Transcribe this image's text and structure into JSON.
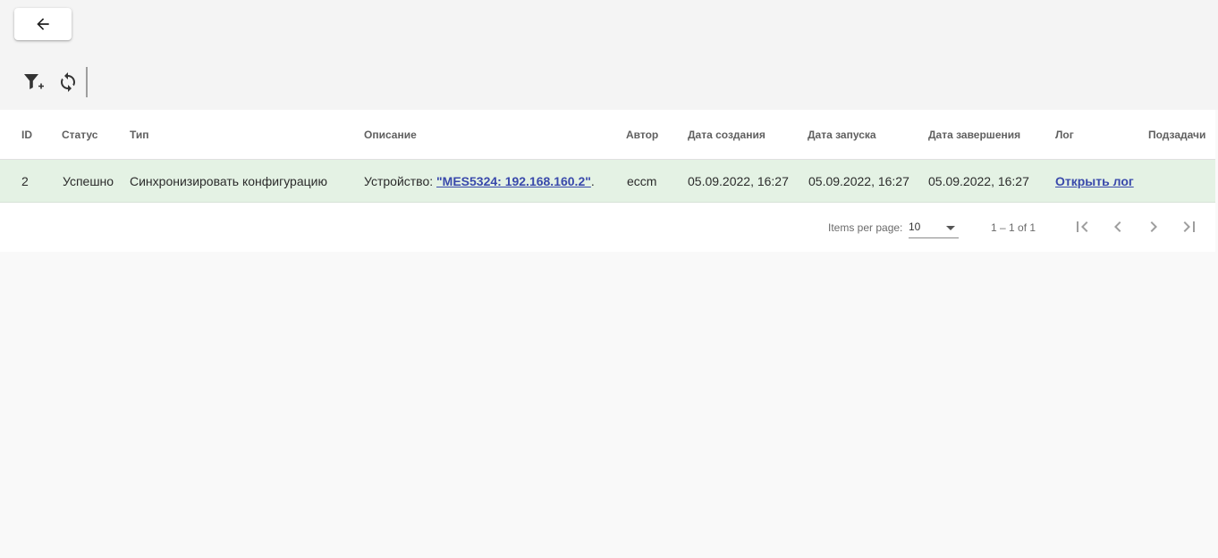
{
  "toolbar": {
    "back_icon": "arrow-left-icon",
    "filter_icon": "filter-add-icon",
    "refresh_icon": "sync-icon"
  },
  "table": {
    "columns": [
      "ID",
      "Статус",
      "Тип",
      "Описание",
      "Автор",
      "Дата создания",
      "Дата запуска",
      "Дата завершения",
      "Лог",
      "Подзадачи"
    ],
    "rows": [
      {
        "id": "2",
        "status": "Успешно",
        "type": "Синхронизировать конфигурацию",
        "description_prefix": "Устройство: ",
        "description_link": "\"MES5324: 192.168.160.2\"",
        "description_suffix": ".",
        "author": "eccm",
        "created": "05.09.2022, 16:27",
        "started": "05.09.2022, 16:27",
        "finished": "05.09.2022, 16:27",
        "log_link": "Открыть лог",
        "subtasks": ""
      }
    ],
    "success_row_color": "#e4f2e4"
  },
  "paginator": {
    "items_per_page_label": "Items per page:",
    "page_size": "10",
    "range_label": "1 – 1 of 1"
  }
}
